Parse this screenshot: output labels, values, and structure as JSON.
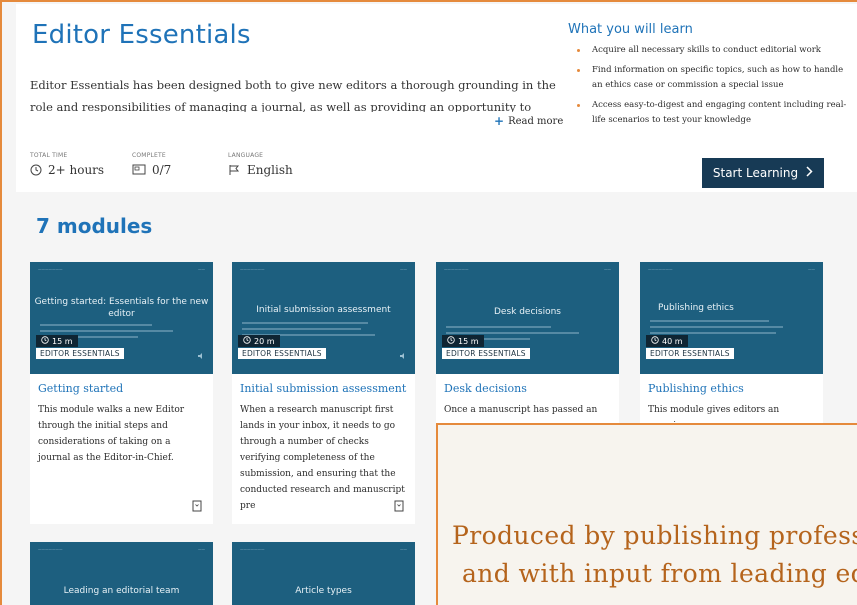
{
  "colors": {
    "accent": "#1f73b8",
    "orange": "#e58a3c",
    "dark_button": "#173a55",
    "thumb_bg": "#1d5f7f"
  },
  "hero": {
    "title": "Editor Essentials",
    "description": "Editor Essentials has been designed both to give new editors a thorough grounding in the role and responsibilities of managing a journal, as well as providing an opportunity to more",
    "read_more": "Read more",
    "meta": {
      "total_time_label": "TOTAL TIME",
      "total_time_value": "2+ hours",
      "complete_label": "COMPLETE",
      "complete_value": "0/7",
      "language_label": "LANGUAGE",
      "language_value": "English"
    },
    "learn_title": "What you will learn",
    "learn_items": [
      "Acquire all necessary skills to conduct editorial work",
      "Find information on specific topics, such as how to handle an ethics case or commission a special issue",
      "Access easy-to-digest and engaging content including real-life scenarios to test your knowledge"
    ],
    "start_button": "Start Learning",
    "start_icon": "chevron-right-icon"
  },
  "modules": {
    "heading": "7 modules",
    "cards": [
      {
        "thumb_title": "Getting started: Essentials for the new editor",
        "duration": "15 m",
        "tag": "EDITOR ESSENTIALS",
        "title": "Getting started",
        "desc": "This module walks a new Editor through the initial steps and considerations of taking on a journal as the Editor-in-Chief."
      },
      {
        "thumb_title": "Initial submission assessment",
        "duration": "20 m",
        "tag": "EDITOR ESSENTIALS",
        "title": "Initial submission assessment",
        "desc": "When a research manuscript first lands in your inbox, it needs to go through a number of checks verifying completeness of the submission, and ensuring that the conducted research and manuscript pre"
      },
      {
        "thumb_title": "Desk decisions",
        "duration": "15 m",
        "tag": "EDITOR ESSENTIALS",
        "title": "Desk decisions",
        "desc": "Once a manuscript has passed an"
      },
      {
        "thumb_title": "Publishing ethics",
        "duration": "40 m",
        "tag": "EDITOR ESSENTIALS",
        "title": "Publishing ethics",
        "desc": "This module gives editors an overview"
      }
    ],
    "row2": [
      {
        "thumb_title": "Leading an editorial team"
      },
      {
        "thumb_title": "Article types"
      }
    ]
  },
  "overlay": {
    "line1": "Produced by publishing professio",
    "line2": "and with input from leading edito"
  }
}
